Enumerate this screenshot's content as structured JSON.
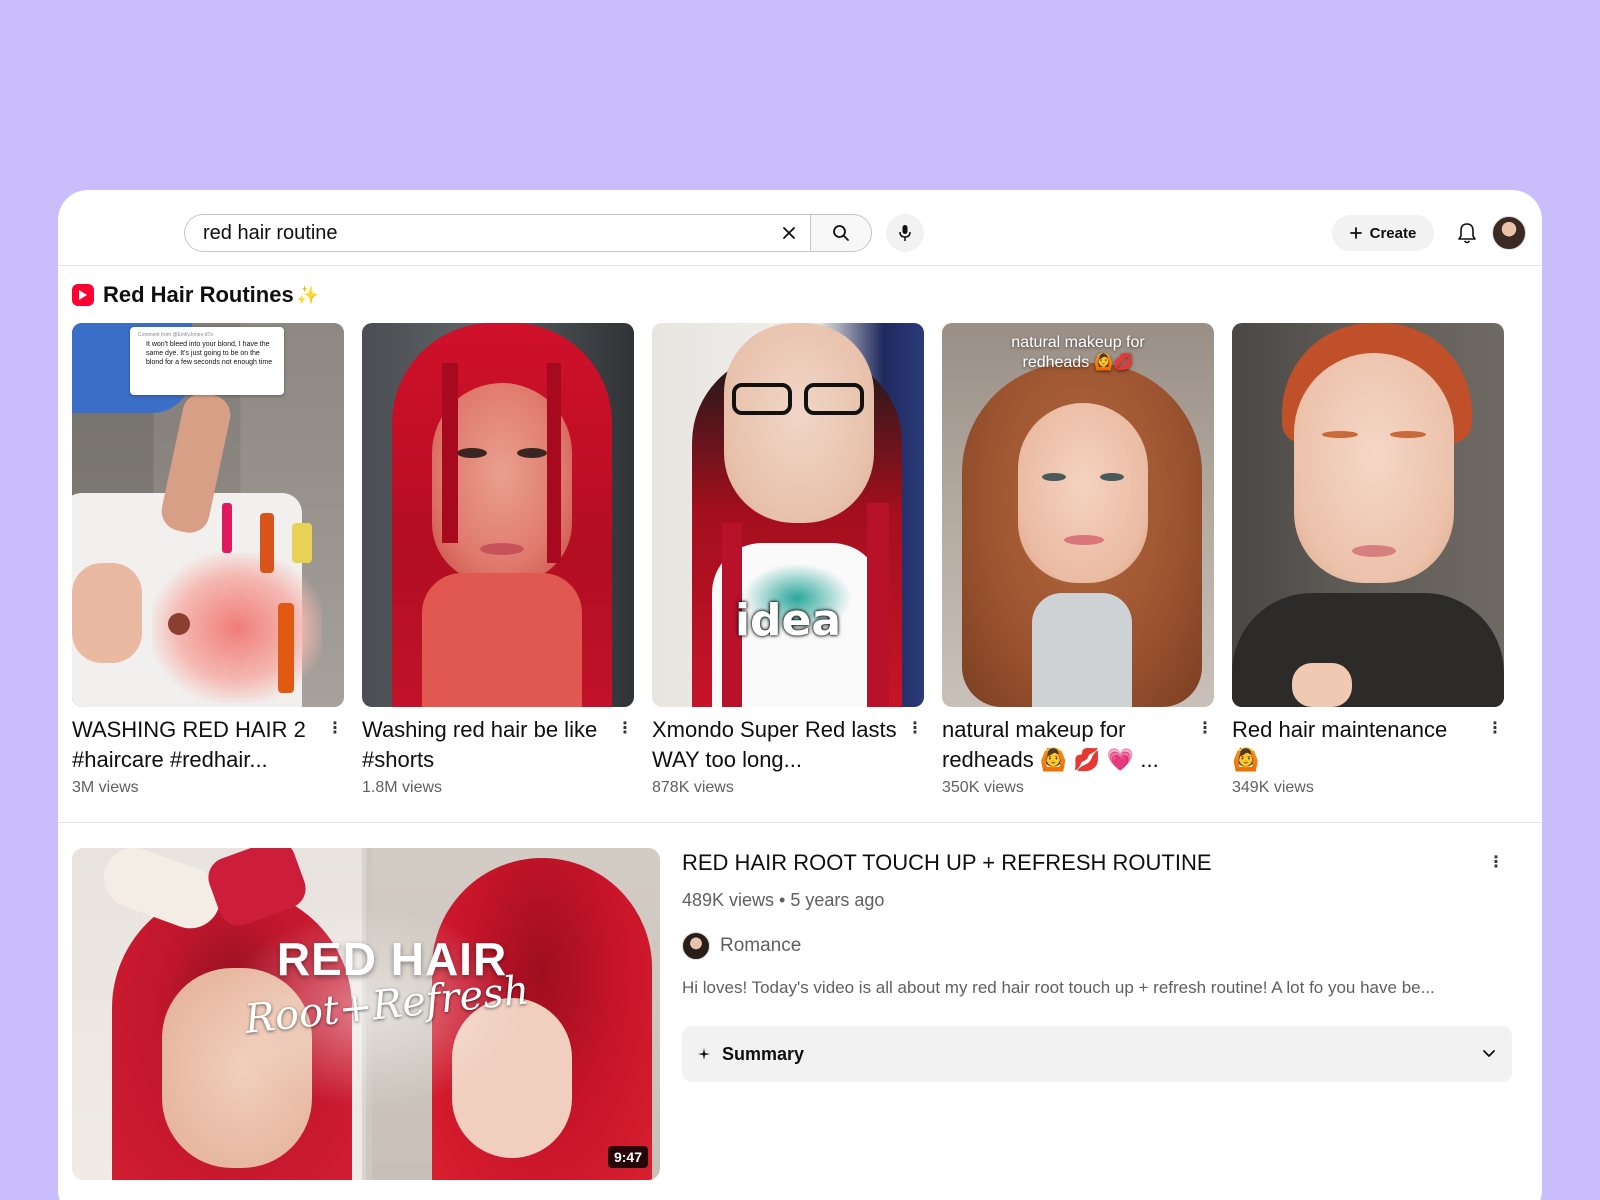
{
  "search": {
    "query": "red hair routine"
  },
  "header": {
    "create_label": "Create"
  },
  "shelf": {
    "title": "Red Hair Routines",
    "title_emoji": "✨",
    "shorts": [
      {
        "title": "WASHING RED HAIR 2 #haircare #redhair...",
        "views": "3M views",
        "comment_header": "Comment from @EmilyJones-d7o",
        "comment_text": "It won't bleed into your blond, I have the same dye. It's just going to be on the blond for a few seconds not enough time"
      },
      {
        "title": "Washing red hair be like #shorts",
        "views": "1.8M views"
      },
      {
        "title": "Xmondo Super Red lasts WAY too long...",
        "views": "878K views",
        "overlay": "idea"
      },
      {
        "title": "natural makeup for redheads 🙆 💋 💗 ...",
        "views": "350K views",
        "overlay": "natural makeup for redheads 🙆💋"
      },
      {
        "title": "Red hair maintenance 🙆",
        "views": "349K views"
      }
    ]
  },
  "video": {
    "title": "RED HAIR ROOT TOUCH UP + REFRESH ROUTINE",
    "meta": "489K views • 5 years ago",
    "channel": "Romance",
    "description": "Hi loves! Today's video is all about my red hair root touch up + refresh routine! A lot fo you have be...",
    "duration": "9:47",
    "thumb_title": "RED HAIR",
    "thumb_subtitle": "Root+Refresh",
    "summary_label": "Summary"
  },
  "colors": {
    "background": "#c9bdfb",
    "shorts_red": "#ff0033"
  },
  "icons": [
    "close-icon",
    "search-icon",
    "mic-icon",
    "plus-icon",
    "bell-icon",
    "shorts-icon",
    "more-vert-icon",
    "sparkle-icon",
    "chevron-down-icon"
  ]
}
